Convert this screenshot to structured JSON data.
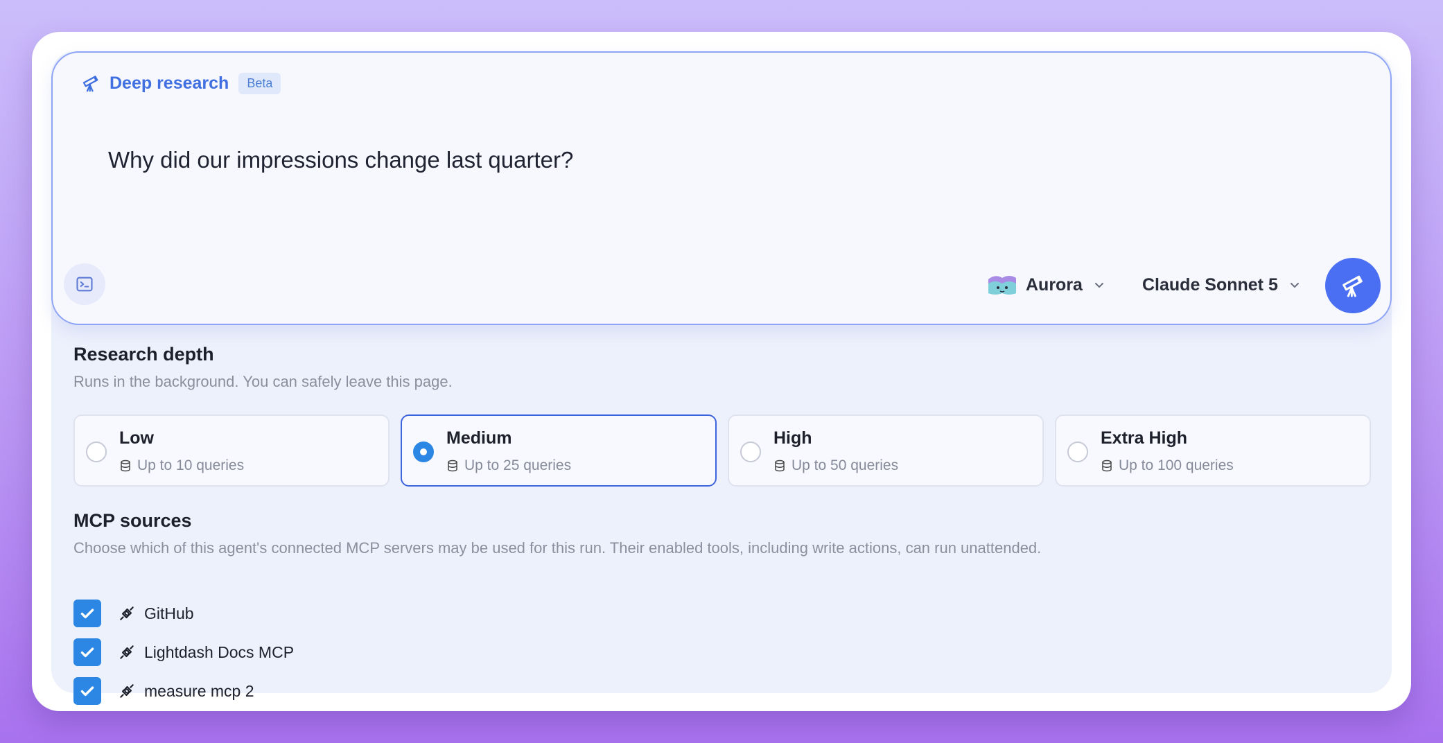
{
  "composer": {
    "mode_title": "Deep research",
    "mode_badge": "Beta",
    "prompt_text": "Why did our impressions change last quarter?",
    "terminal_icon": "terminal-icon",
    "agent": {
      "name": "Aurora",
      "icon": "aurora-agent-icon"
    },
    "model": {
      "name": "Claude Sonnet 5"
    },
    "send_icon": "telescope-icon"
  },
  "research_depth": {
    "title": "Research depth",
    "subtitle": "Runs in the background. You can safely leave this page.",
    "selected": "Medium",
    "options": [
      {
        "label": "Low",
        "sub": "Up to 10 queries",
        "selected": false
      },
      {
        "label": "Medium",
        "sub": "Up to 25 queries",
        "selected": true
      },
      {
        "label": "High",
        "sub": "Up to 50 queries",
        "selected": false
      },
      {
        "label": "Extra High",
        "sub": "Up to 100 queries",
        "selected": false
      }
    ]
  },
  "mcp_sources": {
    "title": "MCP sources",
    "subtitle": "Choose which of this agent's connected MCP servers may be used for this run. Their enabled tools, including write actions, can run unattended.",
    "items": [
      {
        "label": "GitHub",
        "checked": true
      },
      {
        "label": "Lightdash Docs MCP",
        "checked": true
      },
      {
        "label": "measure mcp 2",
        "checked": true
      }
    ]
  },
  "colors": {
    "accent": "#4a6ff2",
    "checkbox": "#2c86e3",
    "mode_title": "#3f6fe0"
  }
}
